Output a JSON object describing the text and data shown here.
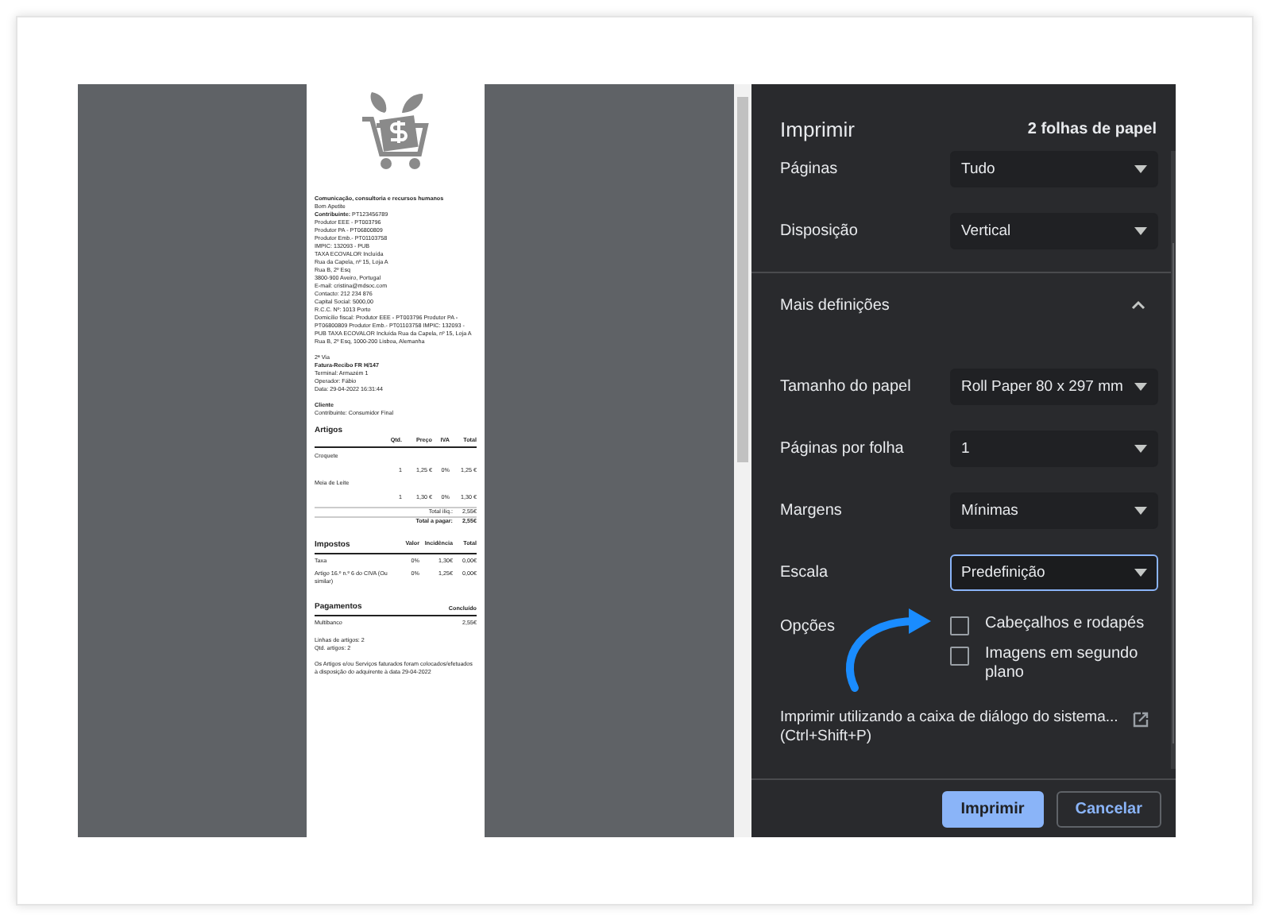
{
  "preview": {
    "receipt": {
      "company_name": "Comunicação, consultoria e recursos humanos",
      "company_lines": [
        "Bom Apetite",
        "**Contribuinte:** PT123456789",
        "Produtor EEE - PT003796",
        "Produtor PA - PT06800809",
        "Produtor Emb.- PT01103758",
        "IMPIC: 132093 - PUB",
        "TAXA ECOVALOR Incluída",
        "Rua da Capela, nº 15, Loja A",
        "Rua B, 2º Esq",
        "3800-900 Aveiro, Portugal",
        "E-mail: cristina@mdsoc.com",
        "Contacto: 212 234 876",
        "Capital Social: 5000,00",
        "R.C.C. Nº: 1013 Porto",
        "Domicílio fiscal: Produtor EEE - PT003796 Produtor PA - PT06800809 Produtor Emb.- PT01103758 IMPIC: 132093 - PUB TAXA ECOVALOR Incluída Rua da Capela, nº 15, Loja A Rua B, 2º Esq, 1000-200 Lisboa, Alemanha"
      ],
      "copy": "2ª Via",
      "document_title": "Fatura-Recibo FR H/147",
      "document_lines": [
        "Terminal: Armazém 1",
        "Operador: Fábio",
        "Data: 29-04-2022 16:31:44"
      ],
      "client_heading": "Cliente",
      "client_line": "Contribuinte: Consumidor Final",
      "items_heading": "Artigos",
      "items_columns": [
        "Qtd.",
        "Preço",
        "IVA",
        "Total"
      ],
      "items": [
        {
          "name": "Croquete",
          "qty": "1",
          "price": "1,25 €",
          "vat": "0%",
          "total": "1,25 €"
        },
        {
          "name": "Meia de Leite",
          "qty": "1",
          "price": "1,30 €",
          "vat": "0%",
          "total": "1,30 €"
        }
      ],
      "totals": [
        {
          "label": "Total ilíq.:",
          "value": "2,55€",
          "bold": false
        },
        {
          "label": "Total a pagar:",
          "value": "2,55€",
          "bold": true
        }
      ],
      "taxes_heading": "Impostos",
      "taxes_columns": [
        "Valor",
        "Incidência",
        "Total"
      ],
      "taxes": [
        {
          "name": "Taxa",
          "rate": "0%",
          "base": "1,30€",
          "total": "0,00€"
        },
        {
          "name": "Artigo 16.º n.º 6 do CIVA (Ou similar)",
          "rate": "0%",
          "base": "1,25€",
          "total": "0,00€"
        }
      ],
      "payments_heading": "Pagamentos",
      "payments_column": "Concluído",
      "payments": [
        {
          "method": "Multibanco",
          "amount": "2,55€"
        }
      ],
      "summary_lines": [
        "Linhas de artigos: 2",
        "Qtd. artigos: 2"
      ],
      "footer_note": "Os Artigos e/ou Serviços faturados foram colocados/efetuados à disposição do adquirente à data 29-04-2022"
    }
  },
  "dialog": {
    "title": "Imprimir",
    "sheets": "2 folhas de papel",
    "settings": [
      {
        "label": "Páginas",
        "value": "Tudo",
        "focused": false
      },
      {
        "label": "Disposição",
        "value": "Vertical",
        "focused": false
      }
    ],
    "more_settings": {
      "label": "Mais definições",
      "expanded": true
    },
    "more": [
      {
        "label": "Tamanho do papel",
        "value": "Roll Paper 80 x 297 mm",
        "focused": false
      },
      {
        "label": "Páginas por folha",
        "value": "1",
        "focused": false
      },
      {
        "label": "Margens",
        "value": "Mínimas",
        "focused": false
      },
      {
        "label": "Escala",
        "value": "Predefinição",
        "focused": true
      }
    ],
    "options": {
      "label": "Opções",
      "items": [
        {
          "label": "Cabeçalhos e rodapés",
          "checked": false
        },
        {
          "label": "Imagens em segundo plano",
          "checked": false
        }
      ]
    },
    "system_dialog": {
      "label": "Imprimir utilizando a caixa de diálogo do sistema... (Ctrl+Shift+P)"
    },
    "buttons": [
      {
        "label": "Imprimir",
        "kind": "primary"
      },
      {
        "label": "Cancelar",
        "kind": "secondary"
      }
    ]
  }
}
